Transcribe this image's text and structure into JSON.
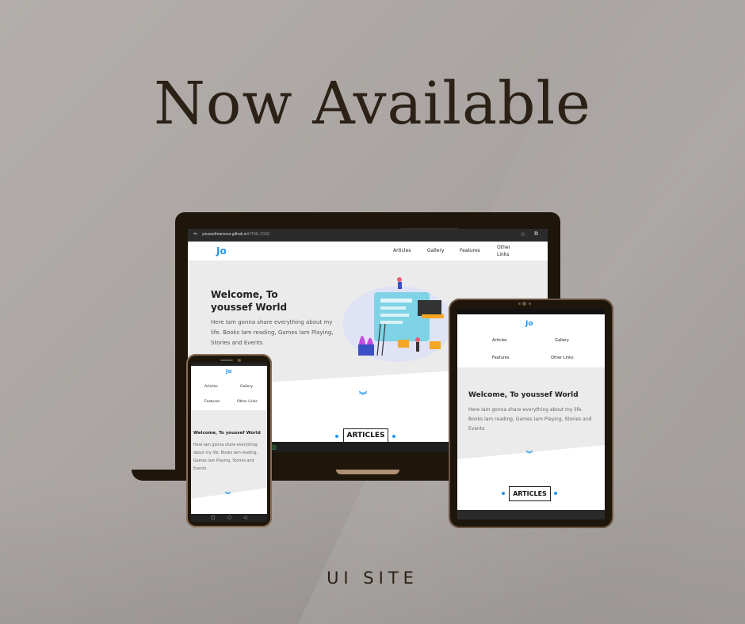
{
  "headline": "Now Available",
  "tagline": "UI SITE",
  "colors": {
    "accent": "#2196f3",
    "frame": "#1f160b",
    "headline": "#2b2116"
  },
  "site": {
    "logo": "Jo",
    "nav": [
      "Articles",
      "Gallery",
      "Features",
      "Other Links"
    ],
    "hero_title": "Welcome, To youssef World",
    "hero_text": "Here Iam gonna share everything about my life. Books Iam reading, Games Iam Playing, Stories and Events",
    "scroll_icon": "double-chevron-down",
    "section_title": "ARTICLES"
  },
  "laptop": {
    "url": "youssefmansour.github.io",
    "url_path": "/HTML-CSS/",
    "star_icon": "star-icon",
    "extension_icon": "extension-icon"
  }
}
